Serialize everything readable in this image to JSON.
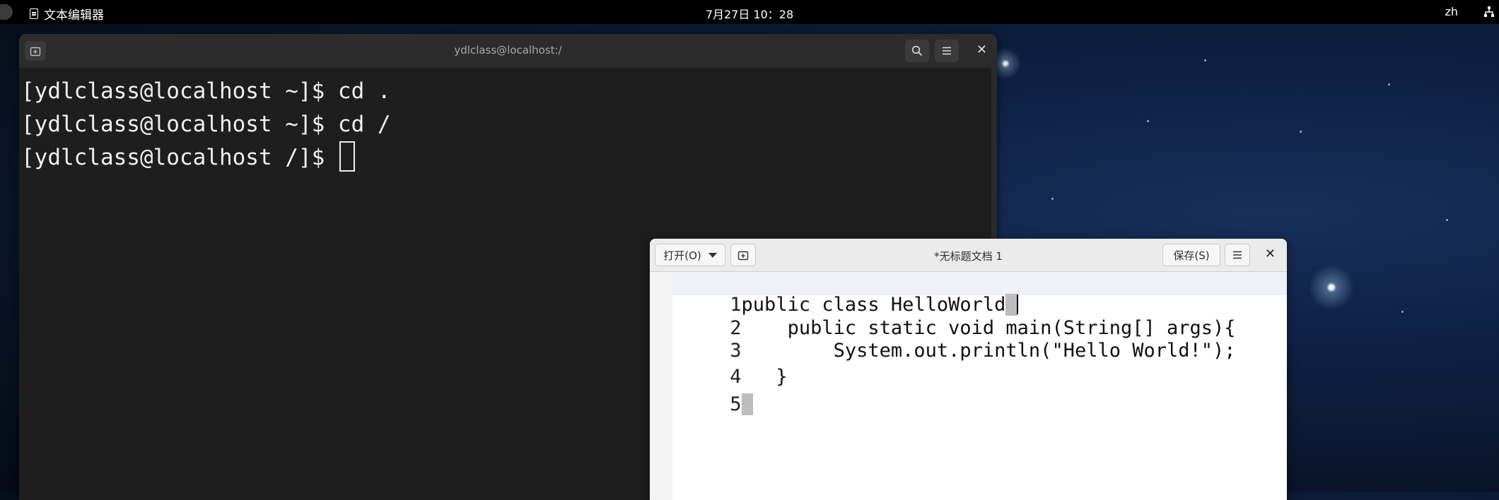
{
  "topbar": {
    "app_name": "文本编辑器",
    "clock": "7月27日  10：28",
    "input_method": "zh"
  },
  "terminal": {
    "title": "ydlclass@localhost:/",
    "lines": [
      "[ydlclass@localhost ~]$ cd .",
      "[ydlclass@localhost ~]$ cd /",
      "[ydlclass@localhost /]$ "
    ]
  },
  "editor": {
    "open_label": "打开(O)",
    "title": "*无标题文档 1",
    "save_label": "保存(S)",
    "lines": [
      {
        "num": "1",
        "code": "public class HelloWorld",
        "bracket": "{"
      },
      {
        "num": "2",
        "code": "    public static void main(String[] args){",
        "bracket": ""
      },
      {
        "num": "3",
        "code": "        System.out.println(\"Hello World!\");",
        "bracket": ""
      },
      {
        "num": "4",
        "code": "   }",
        "bracket": ""
      },
      {
        "num": "5",
        "code": "",
        "bracket": "}"
      }
    ]
  },
  "icons": {
    "activities": "activities-pill",
    "app": "document-icon",
    "network": "network-icon",
    "new_tab": "new-tab-icon",
    "search": "search-icon",
    "menu": "hamburger-menu-icon",
    "close": "close-icon",
    "dropdown": "chevron-down-icon",
    "new_doc": "new-document-icon"
  },
  "colors": {
    "terminal_bg": "#1e1e1e",
    "terminal_header": "#2c2c2c",
    "editor_header": "#ebebeb",
    "bracket_highlight": "#bdbdbd"
  }
}
